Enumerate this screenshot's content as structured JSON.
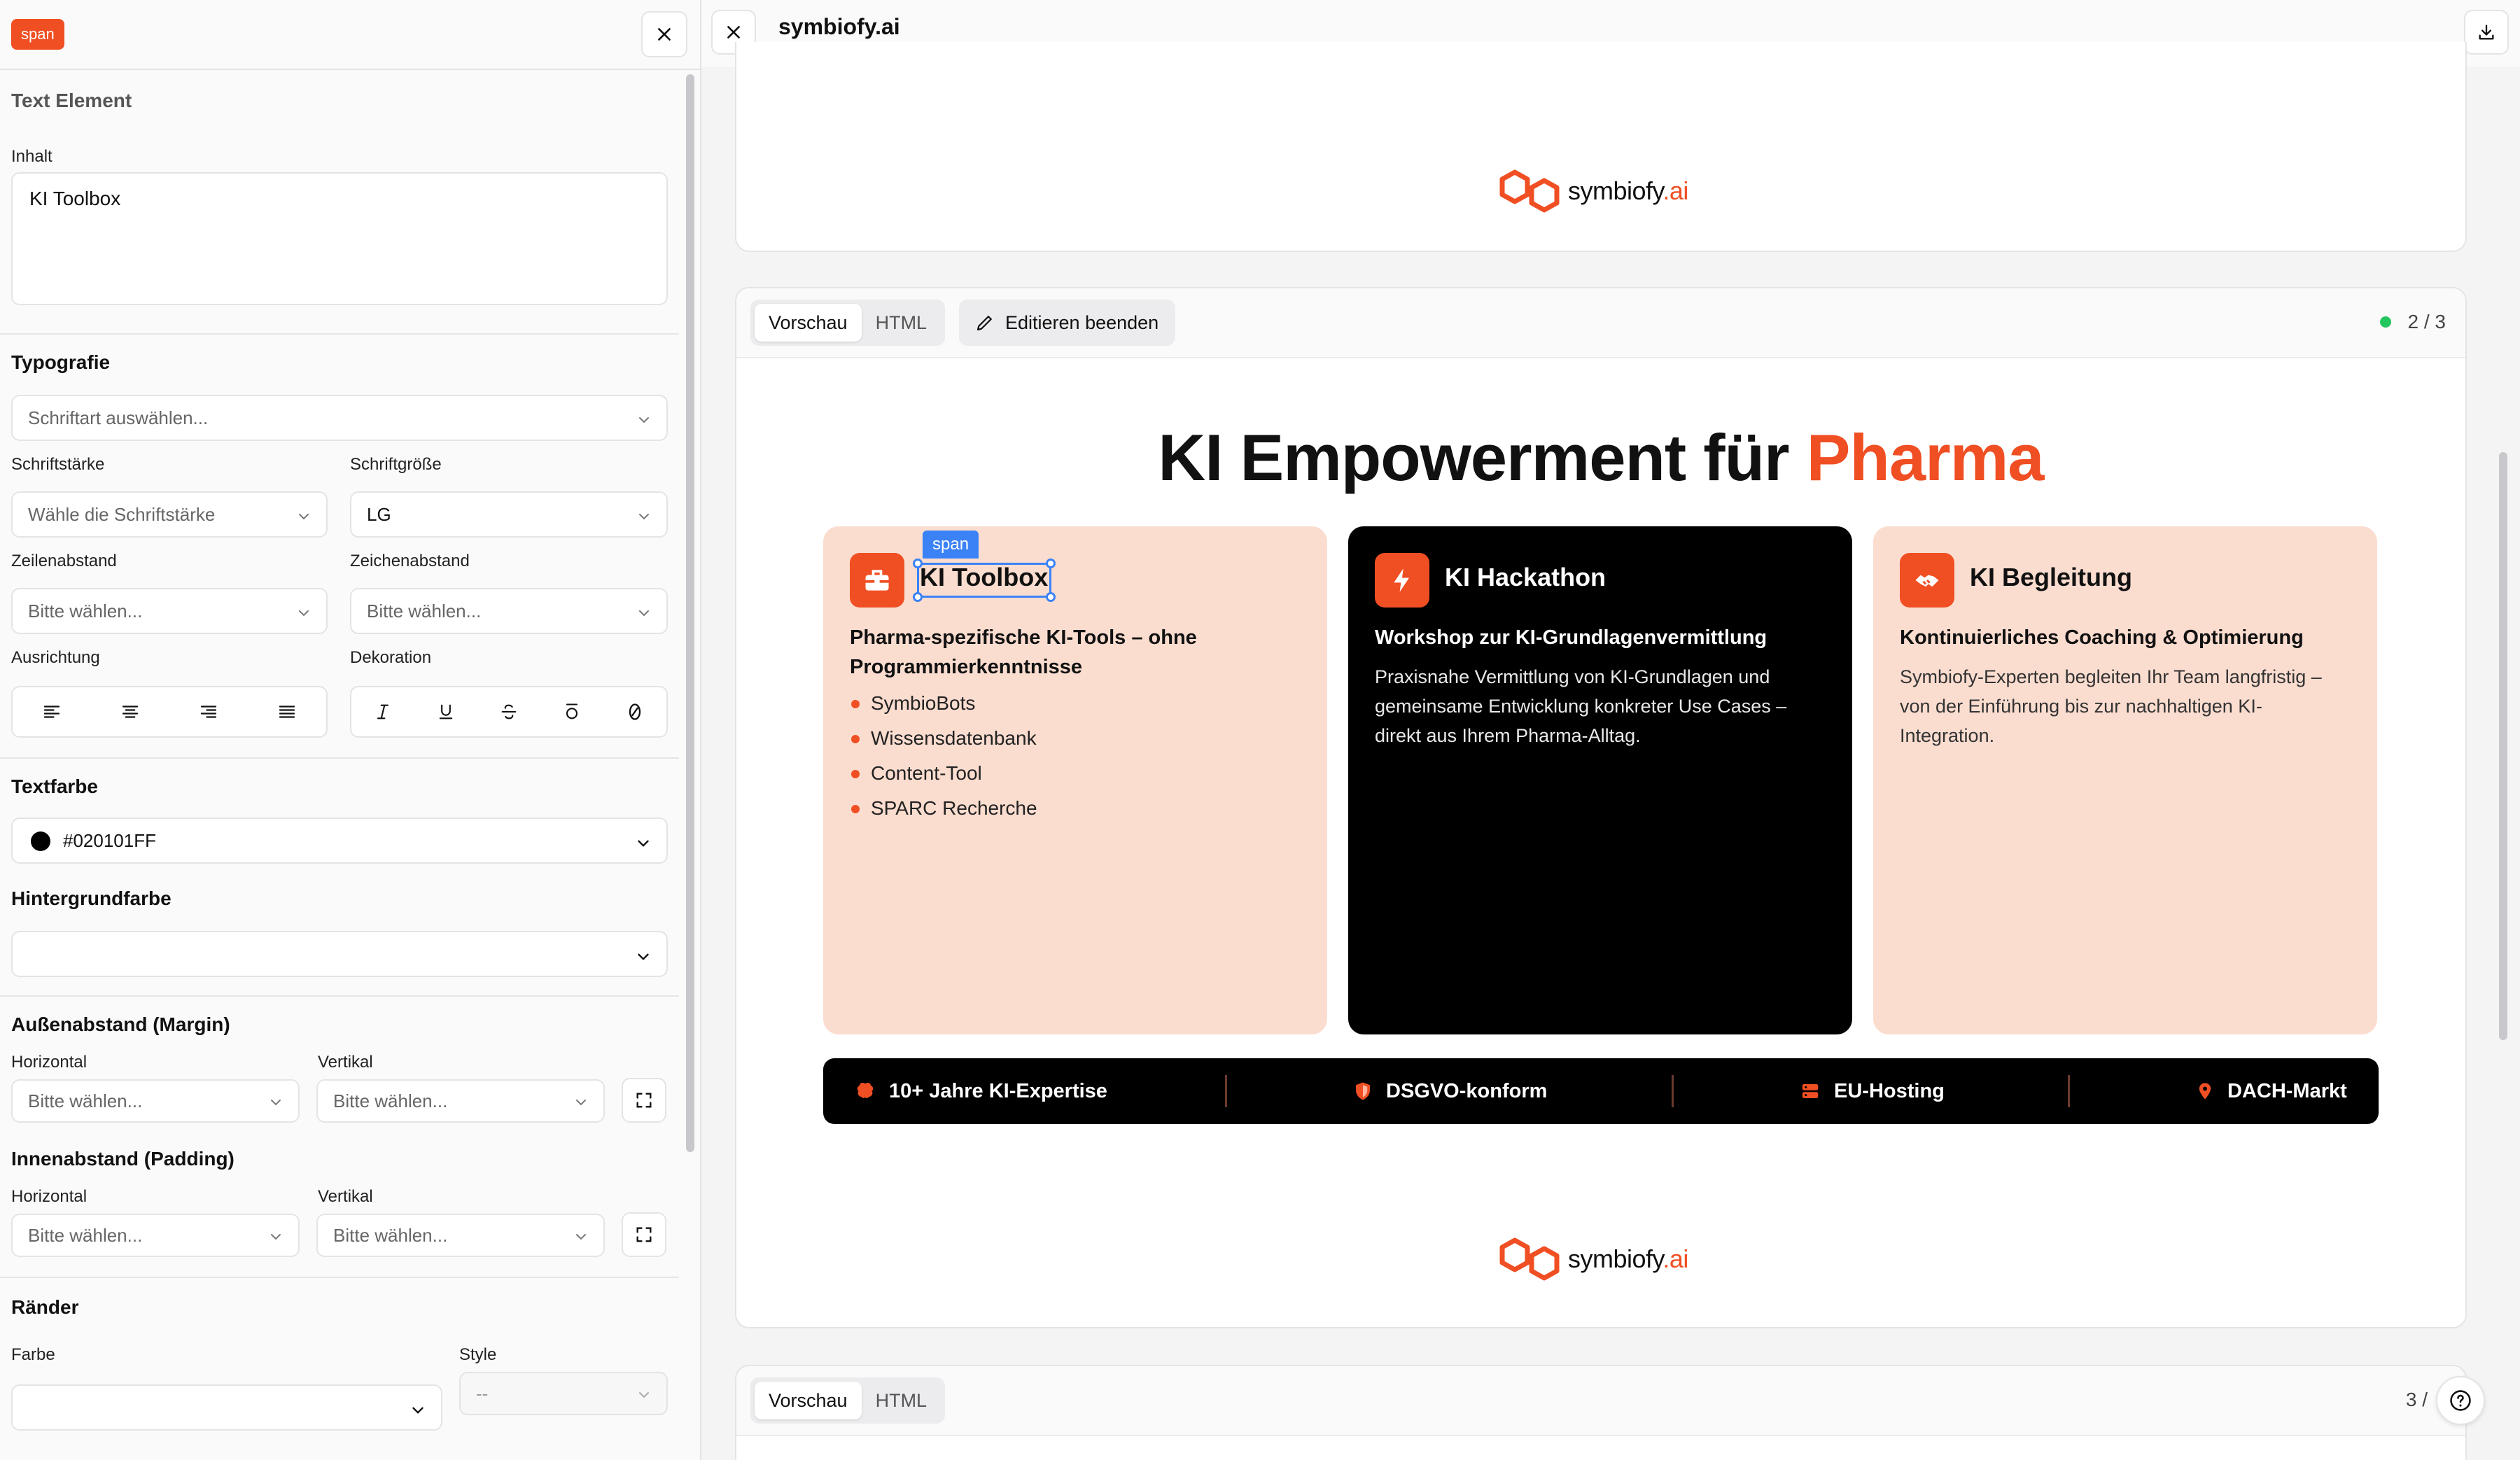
{
  "editor": {
    "element_tag": "span",
    "section_title": "Text Element",
    "content_label": "Inhalt",
    "content_value": "KI Toolbox",
    "typography": {
      "heading": "Typografie",
      "font_placeholder": "Schriftart auswählen...",
      "weight_label": "Schriftstärke",
      "weight_placeholder": "Wähle die Schriftstärke",
      "size_label": "Schriftgröße",
      "size_value": "LG",
      "line_height_label": "Zeilenabstand",
      "line_height_placeholder": "Bitte wählen...",
      "letter_spacing_label": "Zeichenabstand",
      "letter_spacing_placeholder": "Bitte wählen...",
      "align_label": "Ausrichtung",
      "decoration_label": "Dekoration"
    },
    "text_color": {
      "heading": "Textfarbe",
      "value": "#020101FF"
    },
    "background_color": {
      "heading": "Hintergrundfarbe",
      "value": ""
    },
    "margin": {
      "heading": "Außenabstand (Margin)",
      "horizontal_label": "Horizontal",
      "vertical_label": "Vertikal",
      "horizontal_placeholder": "Bitte wählen...",
      "vertical_placeholder": "Bitte wählen..."
    },
    "padding": {
      "heading": "Innenabstand (Padding)",
      "horizontal_label": "Horizontal",
      "vertical_label": "Vertikal",
      "horizontal_placeholder": "Bitte wählen...",
      "vertical_placeholder": "Bitte wählen..."
    },
    "borders": {
      "heading": "Ränder",
      "color_label": "Farbe",
      "style_label": "Style",
      "style_value": "--"
    }
  },
  "preview": {
    "site_title": "symbiofy.ai",
    "logo": {
      "name": "symbiofy",
      "suffix": ".ai"
    },
    "tab_preview": "Vorschau",
    "tab_html": "HTML",
    "edit_button": "Editieren beenden",
    "page_2": "2 / 3",
    "page_3": "3 /",
    "slide": {
      "title_main": "KI Empowerment für ",
      "title_accent": "Pharma",
      "cards": [
        {
          "title": "KI Toolbox",
          "subtitle": "Pharma-spezifische KI-Tools – ohne Programmierkenntnisse",
          "items": [
            "SymbioBots",
            "Wissensdatenbank",
            "Content-Tool",
            "SPARC Recherche"
          ],
          "icon": "toolbox-icon"
        },
        {
          "title": "KI Hackathon",
          "subtitle": "Workshop zur KI-Grundlagenvermittlung",
          "body": "Praxisnahe Vermittlung von KI-Grundlagen und gemeinsame Entwicklung konkreter Use Cases – direkt aus Ihrem Pharma-Alltag.",
          "icon": "lightning-icon"
        },
        {
          "title": "KI Begleitung",
          "subtitle": "Kontinuierliches Coaching & Optimierung",
          "body": "Symbiofy-Experten begleiten Ihr Team langfristig – von der Einführung bis zur nachhaltigen KI-Integration.",
          "icon": "handshake-icon"
        }
      ],
      "stats": [
        "10+ Jahre KI-Expertise",
        "DSGVO-konform",
        "EU-Hosting",
        "DACH-Markt"
      ]
    }
  },
  "colors": {
    "accent": "#f04f23",
    "peach": "#fbddd0",
    "selection": "#3b82f6",
    "status": "#22c55e"
  }
}
